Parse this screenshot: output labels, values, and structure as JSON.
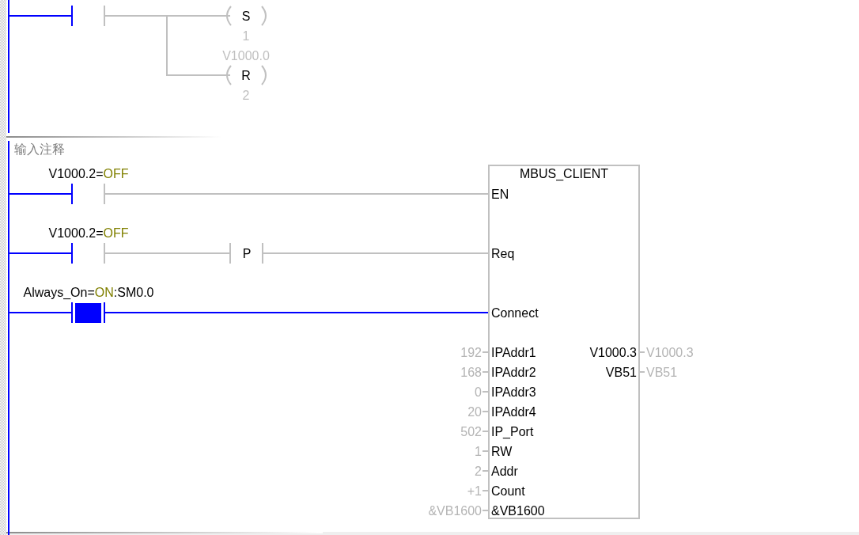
{
  "networks": [
    {
      "rungs": [
        {
          "contact": {
            "closed": false
          },
          "coils": [
            {
              "letter": "S",
              "count": "1"
            },
            {
              "operand": "V1000.0",
              "letter": "R",
              "count": "2"
            }
          ]
        }
      ]
    },
    {
      "comment": "输入注释",
      "rungs": [
        {
          "label": {
            "before": "V1000.2=",
            "state": "OFF"
          },
          "contact": {
            "closed": false
          }
        },
        {
          "label": {
            "before": "V1000.2=",
            "state": "OFF"
          },
          "contact": {
            "closed": false
          },
          "edge": {
            "letter": "P"
          }
        },
        {
          "label": {
            "before": "Always_On=",
            "state": "ON",
            "after": ":SM0.0"
          },
          "contact": {
            "closed": true
          }
        }
      ],
      "block": {
        "title": "MBUS_CLIENT",
        "inputs": [
          {
            "name": "EN"
          },
          {
            "name": "Req"
          },
          {
            "name": "Connect"
          },
          {
            "name": "IPAddr1",
            "value": "192"
          },
          {
            "name": "IPAddr2",
            "value": "168"
          },
          {
            "name": "IPAddr3",
            "value": "0"
          },
          {
            "name": "IPAddr4",
            "value": "20"
          },
          {
            "name": "IP_Port",
            "value": "502"
          },
          {
            "name": "RW",
            "value": "1"
          },
          {
            "name": "Addr",
            "value": "2"
          },
          {
            "name": "Count",
            "value": "+1"
          },
          {
            "name": "&VB1600",
            "value": "&VB1600"
          }
        ],
        "outputs": [
          {
            "name": "V1000.3",
            "value": "V1000.3"
          },
          {
            "name": "VB51",
            "value": "VB51"
          }
        ]
      }
    }
  ]
}
